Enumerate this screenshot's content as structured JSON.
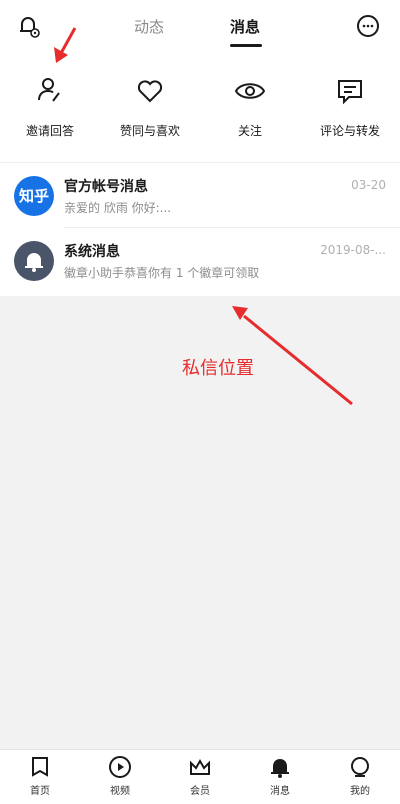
{
  "header": {
    "tabs": [
      {
        "label": "动态",
        "active": false
      },
      {
        "label": "消息",
        "active": true
      }
    ]
  },
  "categories": [
    {
      "label": "邀请回答",
      "icon": "person-edit-icon"
    },
    {
      "label": "赞同与喜欢",
      "icon": "heart-icon"
    },
    {
      "label": "关注",
      "icon": "eye-icon"
    },
    {
      "label": "评论与转发",
      "icon": "comment-icon"
    }
  ],
  "messages": [
    {
      "avatar_text": "知乎",
      "title": "官方帐号消息",
      "preview": "亲爱的 欣雨 你好:...",
      "time": "03-20"
    },
    {
      "avatar_icon": "bell-icon",
      "title": "系统消息",
      "preview": "徽章小助手恭喜你有 1 个徽章可领取",
      "time": "2019-08-..."
    }
  ],
  "annotation": {
    "text": "私信位置",
    "color": "#e62c2c"
  },
  "bottom_nav": [
    {
      "label": "首页",
      "icon": "home-icon"
    },
    {
      "label": "视频",
      "icon": "play-icon"
    },
    {
      "label": "会员",
      "icon": "crown-icon"
    },
    {
      "label": "消息",
      "icon": "bell-icon",
      "active": true
    },
    {
      "label": "我的",
      "icon": "profile-icon"
    }
  ],
  "colors": {
    "accent": "#1772e6",
    "annotation": "#e62c2c",
    "background": "#f2f2f2"
  }
}
